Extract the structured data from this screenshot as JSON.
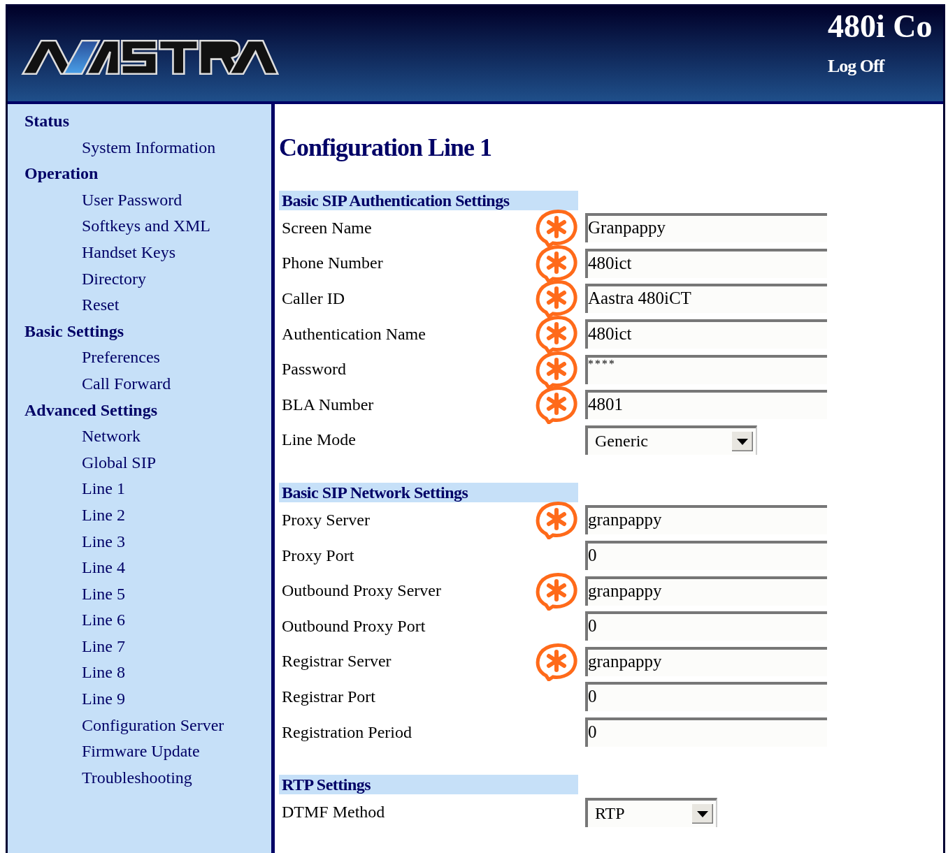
{
  "header": {
    "title": "480i Co",
    "logoff": "Log Off"
  },
  "sidebar": [
    {
      "label": "Status",
      "children": [
        {
          "label": "System Information"
        }
      ]
    },
    {
      "label": "Operation",
      "children": [
        {
          "label": "User Password"
        },
        {
          "label": "Softkeys and XML"
        },
        {
          "label": "Handset Keys"
        },
        {
          "label": "Directory"
        },
        {
          "label": "Reset"
        }
      ]
    },
    {
      "label": "Basic Settings",
      "children": [
        {
          "label": "Preferences"
        },
        {
          "label": "Call Forward"
        }
      ]
    },
    {
      "label": "Advanced Settings",
      "children": [
        {
          "label": "Network"
        },
        {
          "label": "Global SIP"
        },
        {
          "label": "Line 1"
        },
        {
          "label": "Line 2"
        },
        {
          "label": "Line 3"
        },
        {
          "label": "Line 4"
        },
        {
          "label": "Line 5"
        },
        {
          "label": "Line 6"
        },
        {
          "label": "Line 7"
        },
        {
          "label": "Line 8"
        },
        {
          "label": "Line 9"
        },
        {
          "label": "Configuration Server"
        },
        {
          "label": "Firmware Update"
        },
        {
          "label": "Troubleshooting"
        }
      ]
    }
  ],
  "page_title": "Configuration Line 1",
  "sections": [
    {
      "title": "Basic SIP Authentication Settings",
      "fields": [
        {
          "label": "Screen Name",
          "kind": "text",
          "value": "Granpappy",
          "required": true
        },
        {
          "label": "Phone Number",
          "kind": "text",
          "value": "480ict",
          "required": true
        },
        {
          "label": "Caller ID",
          "kind": "text",
          "value": "Aastra 480iCT",
          "required": true
        },
        {
          "label": "Authentication Name",
          "kind": "text",
          "value": "480ict",
          "required": true
        },
        {
          "label": "Password",
          "kind": "password",
          "value": "****",
          "required": true
        },
        {
          "label": "BLA Number",
          "kind": "text",
          "value": "4801",
          "required": true
        },
        {
          "label": "Line Mode",
          "kind": "select",
          "value": "Generic",
          "required": false
        }
      ]
    },
    {
      "title": "Basic SIP Network Settings",
      "fields": [
        {
          "label": "Proxy Server",
          "kind": "text",
          "value": "granpappy",
          "required": true
        },
        {
          "label": "Proxy Port",
          "kind": "text",
          "value": "0",
          "required": false
        },
        {
          "label": "Outbound Proxy Server",
          "kind": "text",
          "value": "granpappy",
          "required": true
        },
        {
          "label": "Outbound Proxy Port",
          "kind": "text",
          "value": "0",
          "required": false
        },
        {
          "label": "Registrar Server",
          "kind": "text",
          "value": "granpappy",
          "required": true
        },
        {
          "label": "Registrar Port",
          "kind": "text",
          "value": "0",
          "required": false
        },
        {
          "label": "Registration Period",
          "kind": "text",
          "value": "0",
          "required": false
        }
      ]
    },
    {
      "title": "RTP Settings",
      "fields": [
        {
          "label": "DTMF Method",
          "kind": "select-small",
          "value": "RTP",
          "required": false
        }
      ]
    }
  ]
}
